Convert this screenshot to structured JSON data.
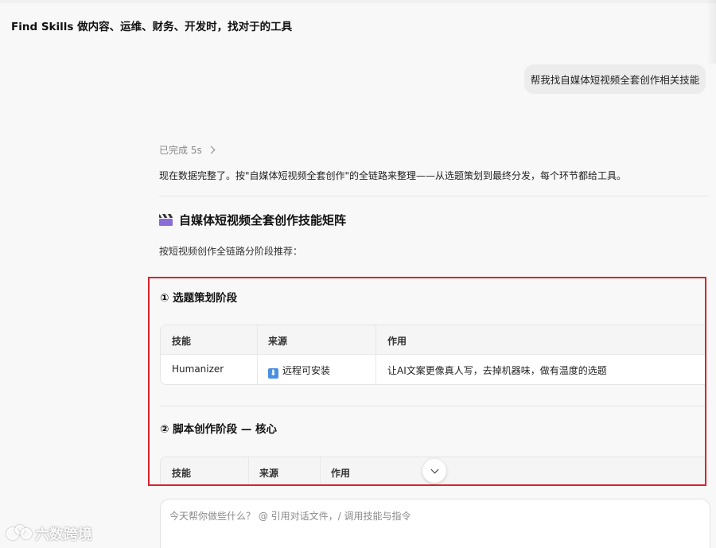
{
  "header": {
    "title": "Find Skills 做内容、运维、财务、开发时，找对于的工具"
  },
  "conversation": {
    "user_message": "帮我找自媒体短视频全套创作相关技能",
    "status_label": "已完成 5s",
    "intro_text": "现在数据完整了。按\"自媒体短视频全套创作\"的全链路来整理——从选题策划到最终分发，每个环节都给工具。",
    "section_title": "自媒体短视频全套创作技能矩阵",
    "section_icon": "clapperboard-icon",
    "section_subtitle": "按短视频创作全链路分阶段推荐："
  },
  "stages": [
    {
      "title": "① 选题策划阶段",
      "headers": [
        "技能",
        "来源",
        "作用"
      ],
      "rows": [
        {
          "skill": "Humanizer",
          "source_icon": "download-icon",
          "source": "远程可安装",
          "purpose": "让AI文案更像真人写，去掉机器味，做有温度的选题"
        }
      ]
    },
    {
      "title": "② 脚本创作阶段 — 核心",
      "headers": [
        "技能",
        "来源",
        "作用"
      ]
    }
  ],
  "input": {
    "placeholder": "今天帮你做些什么？ @ 引用对话文件，/ 调用技能与指令"
  },
  "watermark": {
    "text": "六数跨境"
  }
}
